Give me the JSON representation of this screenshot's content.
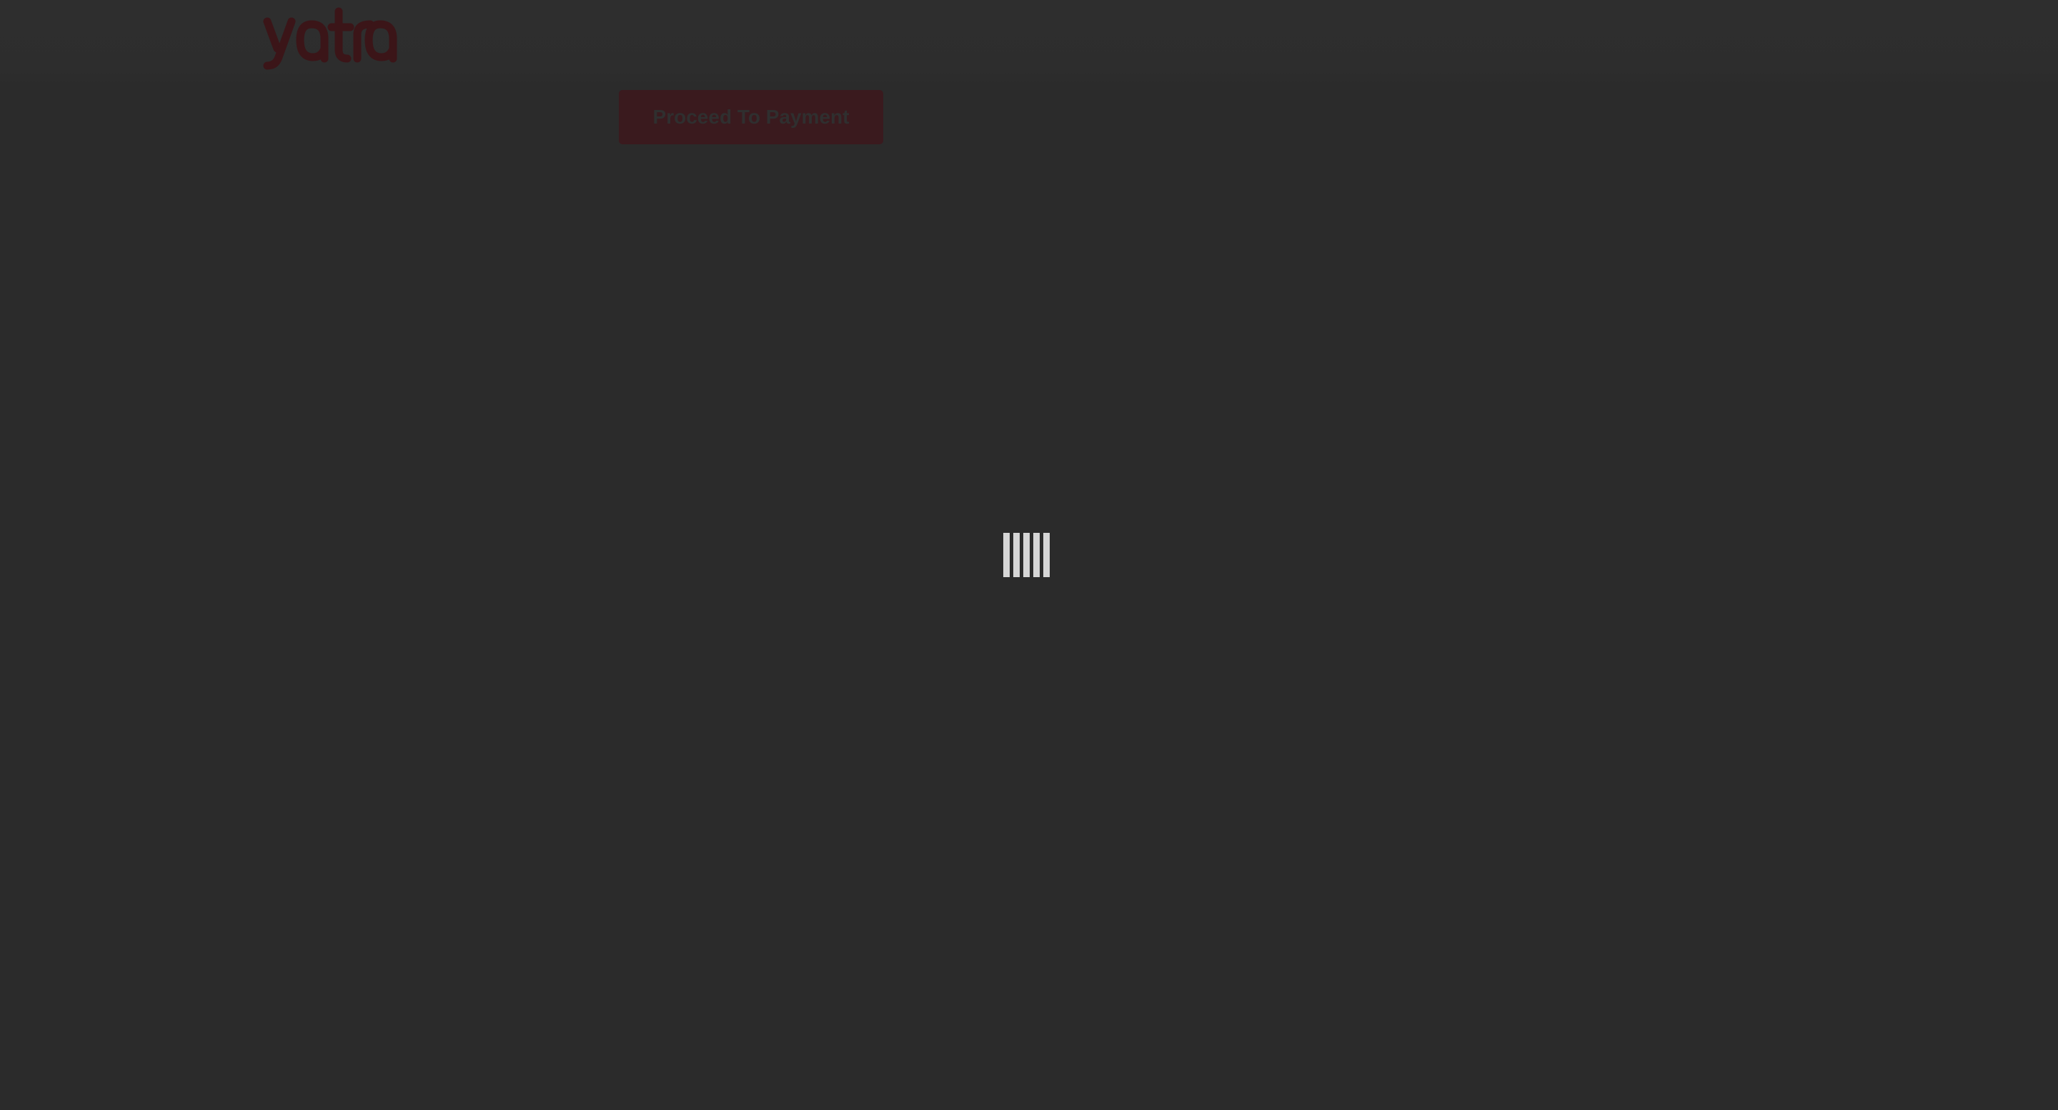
{
  "header": {
    "logo_text": "yatra",
    "logo_color": "#3b1518"
  },
  "main": {
    "proceed_button_label": "Proceed To Payment",
    "button_color": "#3a1a1e"
  },
  "overlay": {
    "background_color": "#2b2b2b",
    "loader_color": "#d6d6d6",
    "loader_icon": "loading-bars-icon"
  }
}
